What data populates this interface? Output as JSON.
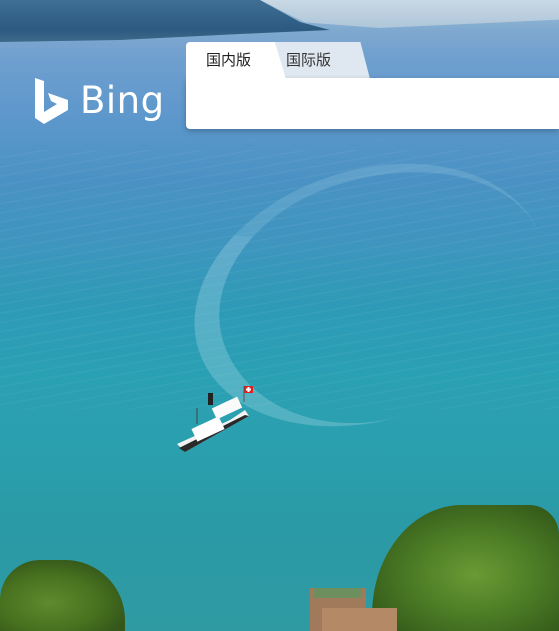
{
  "brand": {
    "logo_text": "Bing"
  },
  "search": {
    "tabs": [
      {
        "label": "国内版",
        "active": true
      },
      {
        "label": "国际版",
        "active": false
      }
    ],
    "input_value": "",
    "placeholder": ""
  },
  "colors": {
    "tab_active": "#ffffff",
    "tab_inactive": "#dfe8f1",
    "logo": "#ffffff"
  }
}
